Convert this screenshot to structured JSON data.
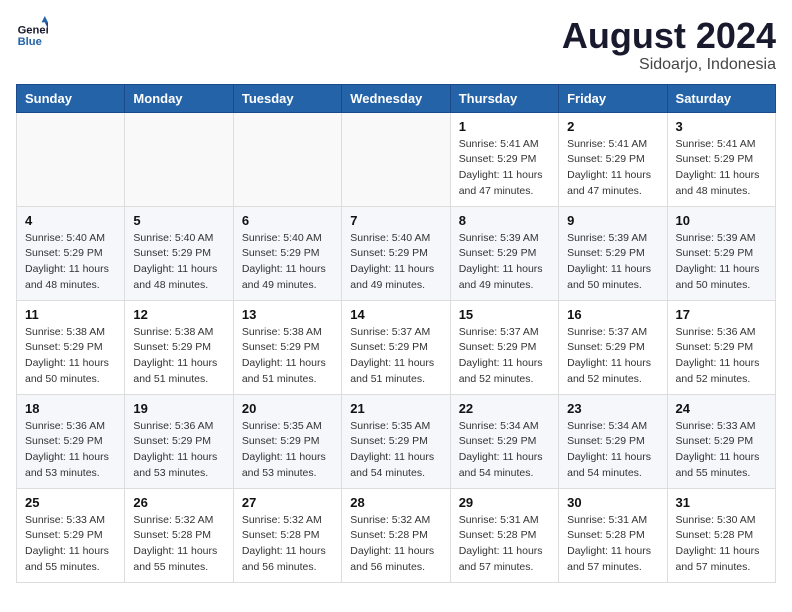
{
  "logo": {
    "text_general": "General",
    "text_blue": "Blue"
  },
  "title": {
    "month_year": "August 2024",
    "location": "Sidoarjo, Indonesia"
  },
  "weekdays": [
    "Sunday",
    "Monday",
    "Tuesday",
    "Wednesday",
    "Thursday",
    "Friday",
    "Saturday"
  ],
  "weeks": [
    [
      {
        "day": "",
        "sunrise": "",
        "sunset": "",
        "daylight": ""
      },
      {
        "day": "",
        "sunrise": "",
        "sunset": "",
        "daylight": ""
      },
      {
        "day": "",
        "sunrise": "",
        "sunset": "",
        "daylight": ""
      },
      {
        "day": "",
        "sunrise": "",
        "sunset": "",
        "daylight": ""
      },
      {
        "day": "1",
        "sunrise": "Sunrise: 5:41 AM",
        "sunset": "Sunset: 5:29 PM",
        "daylight": "Daylight: 11 hours and 47 minutes."
      },
      {
        "day": "2",
        "sunrise": "Sunrise: 5:41 AM",
        "sunset": "Sunset: 5:29 PM",
        "daylight": "Daylight: 11 hours and 47 minutes."
      },
      {
        "day": "3",
        "sunrise": "Sunrise: 5:41 AM",
        "sunset": "Sunset: 5:29 PM",
        "daylight": "Daylight: 11 hours and 48 minutes."
      }
    ],
    [
      {
        "day": "4",
        "sunrise": "Sunrise: 5:40 AM",
        "sunset": "Sunset: 5:29 PM",
        "daylight": "Daylight: 11 hours and 48 minutes."
      },
      {
        "day": "5",
        "sunrise": "Sunrise: 5:40 AM",
        "sunset": "Sunset: 5:29 PM",
        "daylight": "Daylight: 11 hours and 48 minutes."
      },
      {
        "day": "6",
        "sunrise": "Sunrise: 5:40 AM",
        "sunset": "Sunset: 5:29 PM",
        "daylight": "Daylight: 11 hours and 49 minutes."
      },
      {
        "day": "7",
        "sunrise": "Sunrise: 5:40 AM",
        "sunset": "Sunset: 5:29 PM",
        "daylight": "Daylight: 11 hours and 49 minutes."
      },
      {
        "day": "8",
        "sunrise": "Sunrise: 5:39 AM",
        "sunset": "Sunset: 5:29 PM",
        "daylight": "Daylight: 11 hours and 49 minutes."
      },
      {
        "day": "9",
        "sunrise": "Sunrise: 5:39 AM",
        "sunset": "Sunset: 5:29 PM",
        "daylight": "Daylight: 11 hours and 50 minutes."
      },
      {
        "day": "10",
        "sunrise": "Sunrise: 5:39 AM",
        "sunset": "Sunset: 5:29 PM",
        "daylight": "Daylight: 11 hours and 50 minutes."
      }
    ],
    [
      {
        "day": "11",
        "sunrise": "Sunrise: 5:38 AM",
        "sunset": "Sunset: 5:29 PM",
        "daylight": "Daylight: 11 hours and 50 minutes."
      },
      {
        "day": "12",
        "sunrise": "Sunrise: 5:38 AM",
        "sunset": "Sunset: 5:29 PM",
        "daylight": "Daylight: 11 hours and 51 minutes."
      },
      {
        "day": "13",
        "sunrise": "Sunrise: 5:38 AM",
        "sunset": "Sunset: 5:29 PM",
        "daylight": "Daylight: 11 hours and 51 minutes."
      },
      {
        "day": "14",
        "sunrise": "Sunrise: 5:37 AM",
        "sunset": "Sunset: 5:29 PM",
        "daylight": "Daylight: 11 hours and 51 minutes."
      },
      {
        "day": "15",
        "sunrise": "Sunrise: 5:37 AM",
        "sunset": "Sunset: 5:29 PM",
        "daylight": "Daylight: 11 hours and 52 minutes."
      },
      {
        "day": "16",
        "sunrise": "Sunrise: 5:37 AM",
        "sunset": "Sunset: 5:29 PM",
        "daylight": "Daylight: 11 hours and 52 minutes."
      },
      {
        "day": "17",
        "sunrise": "Sunrise: 5:36 AM",
        "sunset": "Sunset: 5:29 PM",
        "daylight": "Daylight: 11 hours and 52 minutes."
      }
    ],
    [
      {
        "day": "18",
        "sunrise": "Sunrise: 5:36 AM",
        "sunset": "Sunset: 5:29 PM",
        "daylight": "Daylight: 11 hours and 53 minutes."
      },
      {
        "day": "19",
        "sunrise": "Sunrise: 5:36 AM",
        "sunset": "Sunset: 5:29 PM",
        "daylight": "Daylight: 11 hours and 53 minutes."
      },
      {
        "day": "20",
        "sunrise": "Sunrise: 5:35 AM",
        "sunset": "Sunset: 5:29 PM",
        "daylight": "Daylight: 11 hours and 53 minutes."
      },
      {
        "day": "21",
        "sunrise": "Sunrise: 5:35 AM",
        "sunset": "Sunset: 5:29 PM",
        "daylight": "Daylight: 11 hours and 54 minutes."
      },
      {
        "day": "22",
        "sunrise": "Sunrise: 5:34 AM",
        "sunset": "Sunset: 5:29 PM",
        "daylight": "Daylight: 11 hours and 54 minutes."
      },
      {
        "day": "23",
        "sunrise": "Sunrise: 5:34 AM",
        "sunset": "Sunset: 5:29 PM",
        "daylight": "Daylight: 11 hours and 54 minutes."
      },
      {
        "day": "24",
        "sunrise": "Sunrise: 5:33 AM",
        "sunset": "Sunset: 5:29 PM",
        "daylight": "Daylight: 11 hours and 55 minutes."
      }
    ],
    [
      {
        "day": "25",
        "sunrise": "Sunrise: 5:33 AM",
        "sunset": "Sunset: 5:29 PM",
        "daylight": "Daylight: 11 hours and 55 minutes."
      },
      {
        "day": "26",
        "sunrise": "Sunrise: 5:32 AM",
        "sunset": "Sunset: 5:28 PM",
        "daylight": "Daylight: 11 hours and 55 minutes."
      },
      {
        "day": "27",
        "sunrise": "Sunrise: 5:32 AM",
        "sunset": "Sunset: 5:28 PM",
        "daylight": "Daylight: 11 hours and 56 minutes."
      },
      {
        "day": "28",
        "sunrise": "Sunrise: 5:32 AM",
        "sunset": "Sunset: 5:28 PM",
        "daylight": "Daylight: 11 hours and 56 minutes."
      },
      {
        "day": "29",
        "sunrise": "Sunrise: 5:31 AM",
        "sunset": "Sunset: 5:28 PM",
        "daylight": "Daylight: 11 hours and 57 minutes."
      },
      {
        "day": "30",
        "sunrise": "Sunrise: 5:31 AM",
        "sunset": "Sunset: 5:28 PM",
        "daylight": "Daylight: 11 hours and 57 minutes."
      },
      {
        "day": "31",
        "sunrise": "Sunrise: 5:30 AM",
        "sunset": "Sunset: 5:28 PM",
        "daylight": "Daylight: 11 hours and 57 minutes."
      }
    ]
  ]
}
